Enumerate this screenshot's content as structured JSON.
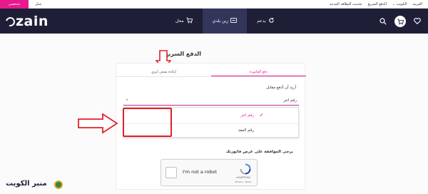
{
  "utility_bar": {
    "tab_personal": "شخصي",
    "tab_business": "عمل",
    "links": [
      "العربية",
      "الكويت",
      "الدفع السريع",
      "تحديث البطاقة المدنية"
    ]
  },
  "brand": {
    "logo_text": "zain"
  },
  "nav": {
    "items": [
      {
        "label": "يدعم",
        "icon": "refresh-icon"
      },
      {
        "label": "زين بلدي",
        "icon": "sim-icon"
      },
      {
        "label": "محل",
        "icon": "cart-icon"
      }
    ],
    "active_index": 1
  },
  "page": {
    "title": "الدفع السريع"
  },
  "tabs": [
    {
      "label": "إعادة شحن ايزي"
    },
    {
      "label": "دفع الفاتورة"
    }
  ],
  "form": {
    "want_label": "أريد أن أدفع مقابل",
    "selected_value": "رقم اخر",
    "options": [
      "رقم اخر",
      "رقم العقد"
    ],
    "agree_text": "يرجى الموافقة على عرض فاتورتك"
  },
  "recaptcha": {
    "label": "I'm not a robot",
    "brand": "reCAPTCHA",
    "links": "Privacy - Terms"
  },
  "watermark": {
    "text": "منبر الكويت"
  },
  "colors": {
    "accent": "#e8198b",
    "nav_bg": "#1e1f37",
    "annotation_red": "#e0212a"
  }
}
